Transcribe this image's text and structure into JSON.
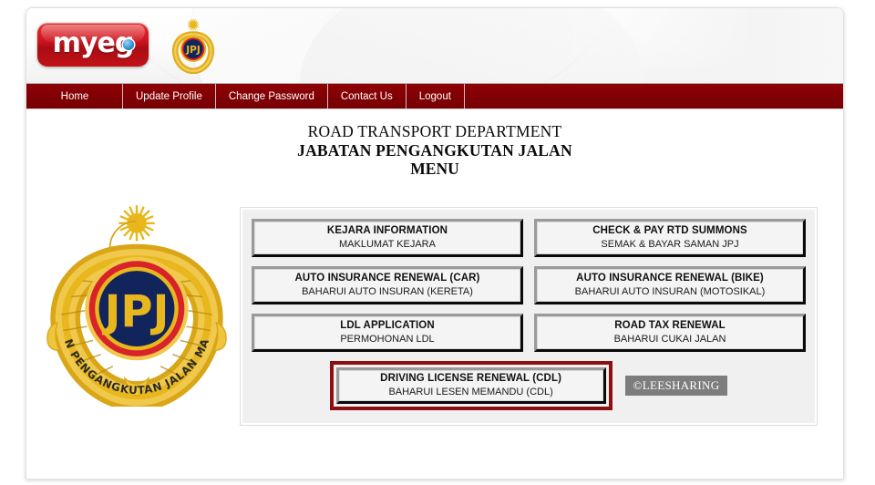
{
  "brand": {
    "logo_text": "myeg",
    "logo_icon": "globe-dot-icon",
    "emblem_name": "jpj-emblem",
    "emblem_motto": "JABATAN PENGANGKUTAN JALAN MALAYSIA",
    "emblem_monogram": "JPJ"
  },
  "nav": {
    "items": [
      {
        "label": "Home"
      },
      {
        "label": "Update Profile"
      },
      {
        "label": "Change Password"
      },
      {
        "label": "Contact Us"
      },
      {
        "label": "Logout"
      }
    ]
  },
  "header": {
    "title_en": "ROAD TRANSPORT DEPARTMENT",
    "title_ms": "JABATAN PENGANGKUTAN JALAN",
    "title_menu": "MENU"
  },
  "menu": {
    "buttons": [
      {
        "en": "KEJARA INFORMATION",
        "ms": "MAKLUMAT KEJARA"
      },
      {
        "en": "CHECK & PAY RTD SUMMONS",
        "ms": "SEMAK & BAYAR SAMAN JPJ"
      },
      {
        "en": "AUTO INSURANCE RENEWAL (CAR)",
        "ms": "BAHARUI AUTO INSURAN (KERETA)"
      },
      {
        "en": "AUTO INSURANCE RENEWAL (BIKE)",
        "ms": "BAHARUI AUTO INSURAN (MOTOSIKAL)"
      },
      {
        "en": "LDL APPLICATION",
        "ms": "PERMOHONAN LDL"
      },
      {
        "en": "ROAD TAX RENEWAL",
        "ms": "BAHARUI CUKAI JALAN"
      }
    ],
    "highlighted": {
      "en": "DRIVING LICENSE RENEWAL (CDL)",
      "ms": "BAHARUI LESEN MEMANDU (CDL)",
      "highlight_color": "#8d0f10"
    }
  },
  "watermark": {
    "text": "©LEESHARING"
  },
  "colors": {
    "nav_red": "#820004",
    "logo_red": "#cf1420",
    "panel_gray": "#f0f0f0",
    "button_face": "#f4f4f4",
    "emblem_gold": "#e8b71d",
    "emblem_navy": "#11255c",
    "emblem_red": "#d8232a"
  }
}
